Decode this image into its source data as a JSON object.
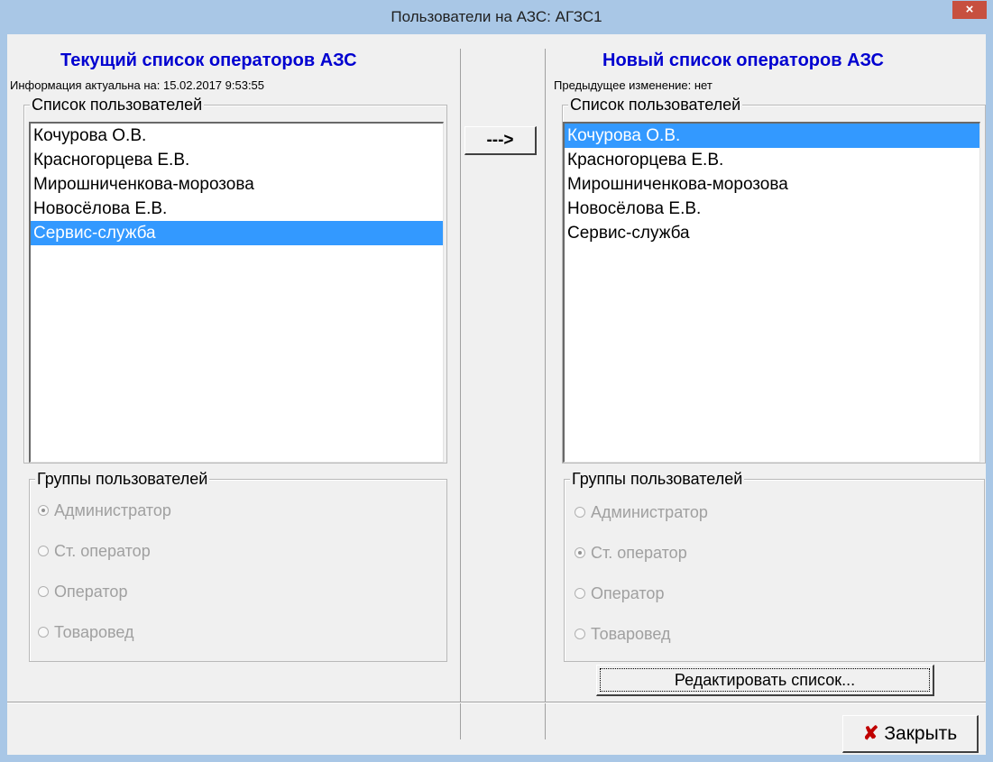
{
  "window": {
    "title": "Пользователи на АЗС: АГЗС1",
    "close_glyph": "×"
  },
  "left_panel": {
    "title": "Текущий список операторов АЗС",
    "info": "Информация актуальна на:  15.02.2017 9:53:55",
    "users_group_label": "Список пользователей",
    "users": [
      "Кочурова О.В.",
      "Красногорцева Е.В.",
      "Мирошниченкова-морозова",
      "Новосёлова Е.В.",
      "Сервис-служба"
    ],
    "selected_user_index": 4,
    "groups_label": "Группы пользователей",
    "groups": [
      "Администратор",
      "Ст. оператор",
      "Оператор",
      "Товаровед"
    ],
    "selected_group_index": 0
  },
  "copy_button_label": "--->",
  "right_panel": {
    "title": "Новый список операторов АЗС",
    "info": "Предыдущее изменение: нет",
    "users_group_label": "Список пользователей",
    "users": [
      "Кочурова О.В.",
      "Красногорцева Е.В.",
      "Мирошниченкова-морозова",
      "Новосёлова Е.В.",
      "Сервис-служба"
    ],
    "selected_user_index": 0,
    "groups_label": "Группы пользователей",
    "groups": [
      "Администратор",
      "Ст. оператор",
      "Оператор",
      "Товаровед"
    ],
    "selected_group_index": 1,
    "edit_button_label": "Редактировать список..."
  },
  "footer": {
    "close_button_label": "Закрыть",
    "close_icon": "✘"
  },
  "colors": {
    "title_blue": "#0000d0",
    "selection": "#3399ff",
    "titlebar": "#a9c7e6",
    "close_red": "#c7503f"
  }
}
